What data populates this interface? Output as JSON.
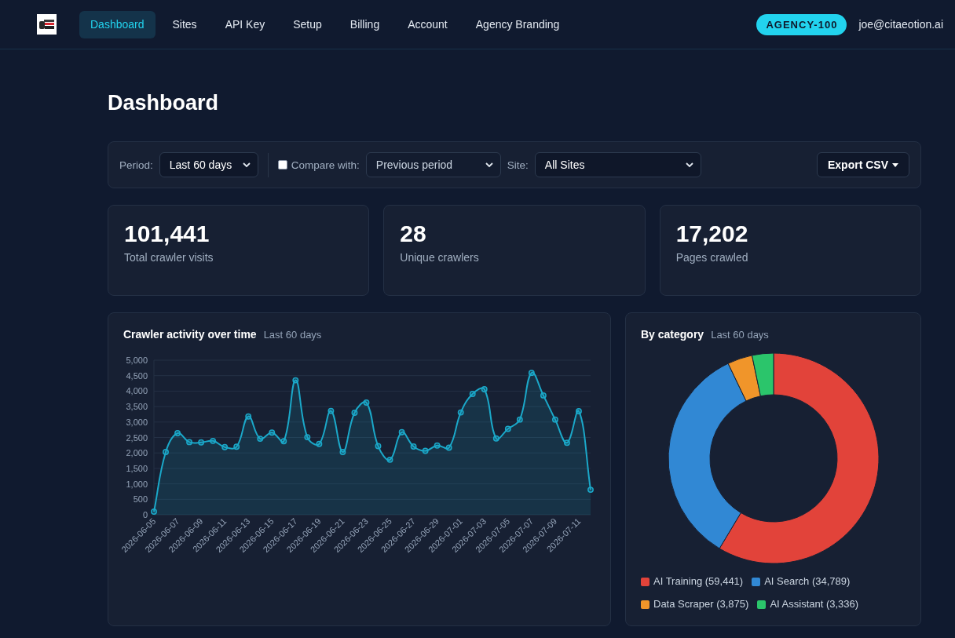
{
  "nav": {
    "items": [
      {
        "label": "Dashboard",
        "selected": true
      },
      {
        "label": "Sites",
        "selected": false
      },
      {
        "label": "API Key",
        "selected": false
      },
      {
        "label": "Setup",
        "selected": false
      },
      {
        "label": "Billing",
        "selected": false
      },
      {
        "label": "Account",
        "selected": false
      },
      {
        "label": "Agency Branding",
        "selected": false
      }
    ],
    "plan_badge": "AGENCY-100",
    "user_email": "joe@citaeotion.ai"
  },
  "page_title": "Dashboard",
  "filters": {
    "period": {
      "label": "Period:",
      "value": "Last 60 days"
    },
    "compare": {
      "checked": false,
      "label": "Compare with:",
      "value": "Previous period",
      "disabled": true
    },
    "site": {
      "label": "Site:",
      "value": "All Sites"
    },
    "export_button": {
      "label": "Export CSV"
    }
  },
  "stats": [
    {
      "value": "101,441",
      "label": "Total crawler visits"
    },
    {
      "value": "28",
      "label": "Unique crawlers"
    },
    {
      "value": "17,202",
      "label": "Pages crawled"
    }
  ],
  "activity_chart": {
    "title": "Crawler activity over time",
    "subtitle": "Last 60 days",
    "chart_data": {
      "type": "area",
      "grid": true,
      "categories": [
        "2026-06-05",
        null,
        "2026-06-07",
        null,
        "2026-06-09",
        null,
        "2026-06-11",
        null,
        "2026-06-13",
        null,
        "2026-06-15",
        null,
        "2026-06-17",
        null,
        "2026-06-19",
        null,
        "2026-06-21",
        null,
        "2026-06-23",
        null,
        "2026-06-25",
        null,
        "2026-06-27",
        null,
        "2026-06-29",
        null,
        "2026-07-01",
        null,
        "2026-07-03",
        null,
        "2026-07-05",
        null,
        "2026-07-07",
        null,
        "2026-07-09",
        null,
        "2026-07-11",
        null
      ],
      "values": [
        100,
        2030,
        2640,
        2350,
        2340,
        2390,
        2190,
        2200,
        3180,
        2460,
        2660,
        2380,
        4350,
        2510,
        2290,
        3360,
        2030,
        3300,
        3630,
        2220,
        1780,
        2670,
        2210,
        2070,
        2240,
        2170,
        3310,
        3910,
        4060,
        2470,
        2780,
        3080,
        4590,
        3860,
        3080,
        2330,
        3350,
        810
      ],
      "ylim": [
        0,
        5000
      ],
      "yticks": [
        {
          "value": 0,
          "label": "0"
        },
        {
          "value": 500,
          "label": "500"
        },
        {
          "value": 1000,
          "label": "1,000"
        },
        {
          "value": 1500,
          "label": "1,500"
        },
        {
          "value": 2000,
          "label": "2,000"
        },
        {
          "value": 2500,
          "label": "2,500"
        },
        {
          "value": 3000,
          "label": "3,000"
        },
        {
          "value": 3500,
          "label": "3,500"
        },
        {
          "value": 4000,
          "label": "4,000"
        },
        {
          "value": 4500,
          "label": "4,500"
        },
        {
          "value": 5000,
          "label": "5,000"
        }
      ]
    }
  },
  "category_chart": {
    "title": "By category",
    "subtitle": "Last 60 days",
    "chart_data": {
      "type": "donut",
      "categories": [
        "AI Training (59,441)",
        "AI Search (34,789)",
        "Data Scraper (3,875)",
        "AI Assistant (3,336)"
      ],
      "values": [
        59441,
        34789,
        3875,
        3336
      ],
      "colors": [
        "#e2433a",
        "#3188d4",
        "#f0952a",
        "#2bc56b"
      ]
    }
  }
}
